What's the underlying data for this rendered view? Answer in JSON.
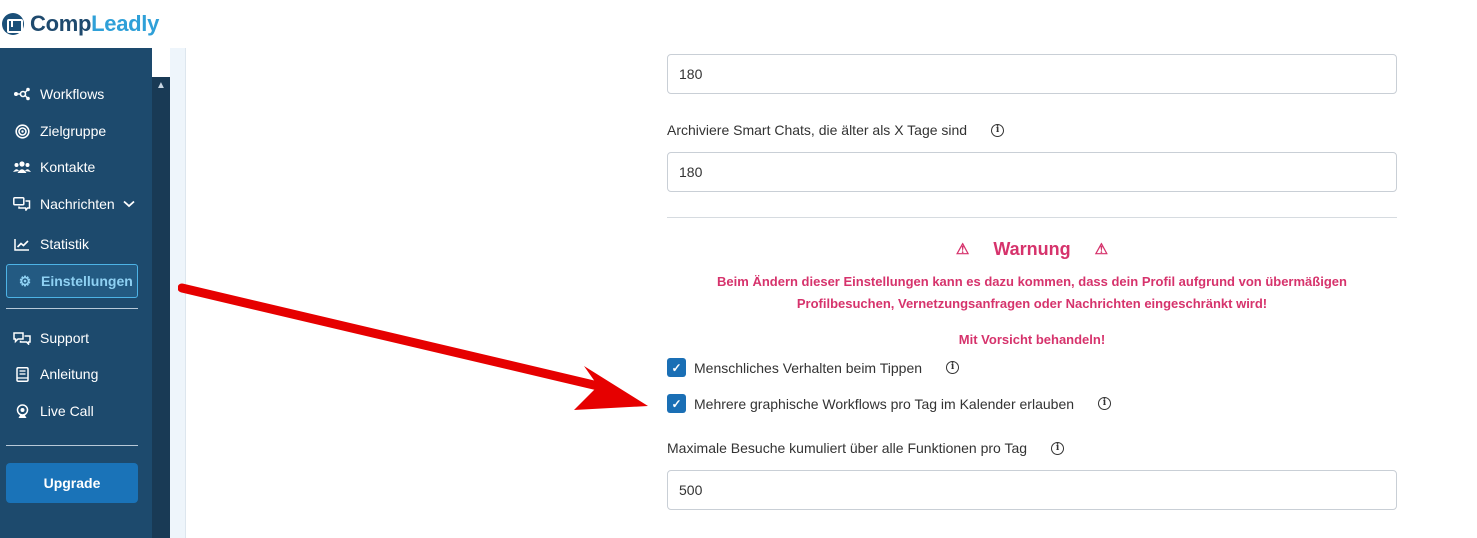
{
  "brand": {
    "part1": "Comp",
    "part2": "Leadly"
  },
  "sidebar": {
    "items": [
      {
        "label": "Workflows",
        "icon": "workflow-icon"
      },
      {
        "label": "Zielgruppe",
        "icon": "target-icon"
      },
      {
        "label": "Kontakte",
        "icon": "contacts-icon"
      },
      {
        "label": "Nachrichten",
        "icon": "messages-icon"
      },
      {
        "label": "Statistik",
        "icon": "chart-icon"
      },
      {
        "label": "Einstellungen",
        "icon": "gear-icon"
      },
      {
        "label": "Support",
        "icon": "support-icon"
      },
      {
        "label": "Anleitung",
        "icon": "book-icon"
      },
      {
        "label": "Live Call",
        "icon": "webcam-icon"
      }
    ],
    "upgrade_label": "Upgrade"
  },
  "main": {
    "field1_value": "180",
    "archive_label": "Archiviere Smart Chats, die älter als X Tage sind",
    "field2_value": "180",
    "warning": {
      "title": "Warnung",
      "line1": "Beim Ändern dieser Einstellungen kann es dazu kommen, dass dein Profil aufgrund von übermäßigen",
      "line2": "Profilbesuchen, Vernetzungsanfragen oder Nachrichten eingeschränkt wird!",
      "caution": "Mit Vorsicht behandeln!"
    },
    "checkbox1_label": "Menschliches Verhalten beim Tippen",
    "checkbox1_checked": true,
    "checkbox2_label": "Mehrere graphische Workflows pro Tag im Kalender erlauben",
    "checkbox2_checked": true,
    "max_visits_label": "Maximale Besuche kumuliert über alle Funktionen pro Tag",
    "field3_value": "500"
  },
  "colors": {
    "sidebar_bg": "#1d4a6d",
    "accent": "#1a73b8",
    "warning": "#d6336c",
    "arrow": "#e60000"
  }
}
